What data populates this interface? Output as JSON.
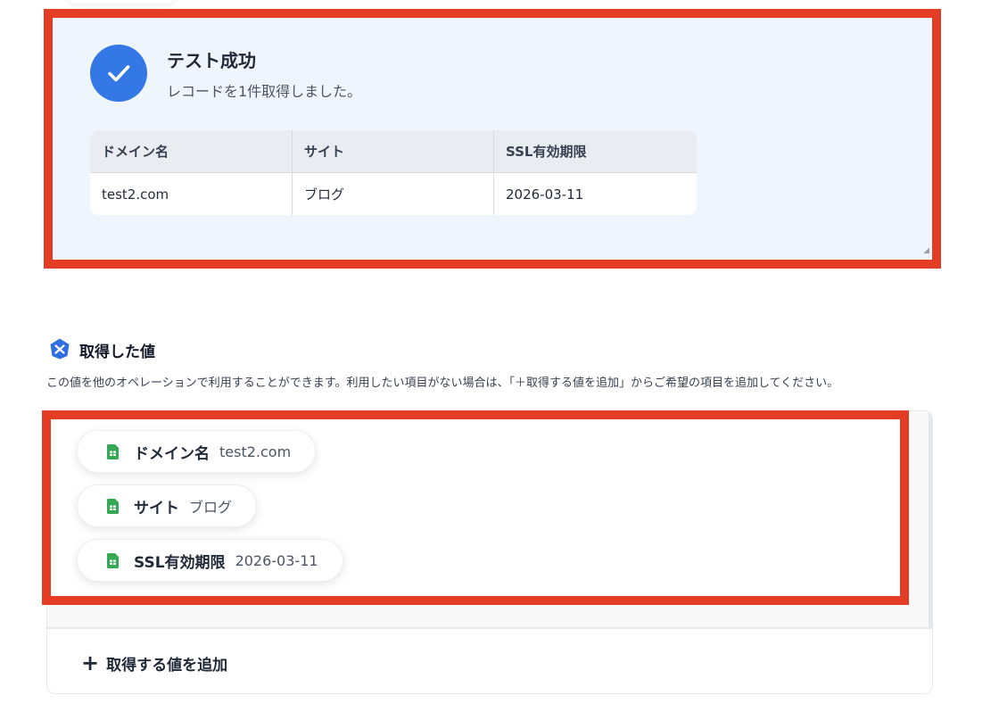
{
  "success": {
    "title": "テスト成功",
    "message": "レコードを1件取得しました。",
    "table": {
      "headers": [
        "ドメイン名",
        "サイト",
        "SSL有効期限"
      ],
      "rows": [
        [
          "test2.com",
          "ブログ",
          "2026-03-11"
        ]
      ]
    }
  },
  "acquired": {
    "title": "取得した値",
    "description": "この値を他のオペレーションで利用することができます。利用したい項目がない場合は、「＋取得する値を追加」からご希望の項目を追加してください。",
    "items": [
      {
        "label": "ドメイン名",
        "value": "test2.com"
      },
      {
        "label": "サイト",
        "value": "ブログ"
      },
      {
        "label": "SSL有効期限",
        "value": "2026-03-11"
      }
    ],
    "add_button_label": "取得する値を追加"
  },
  "icons": {
    "success": "check-circle-icon",
    "section": "yoom-logo-icon",
    "item": "google-sheets-icon",
    "add": "plus-icon"
  },
  "colors": {
    "accent_blue": "#3478e6",
    "highlight_red": "#e43d25",
    "sheets_green": "#34a853",
    "success_bg": "#eff5fd"
  }
}
